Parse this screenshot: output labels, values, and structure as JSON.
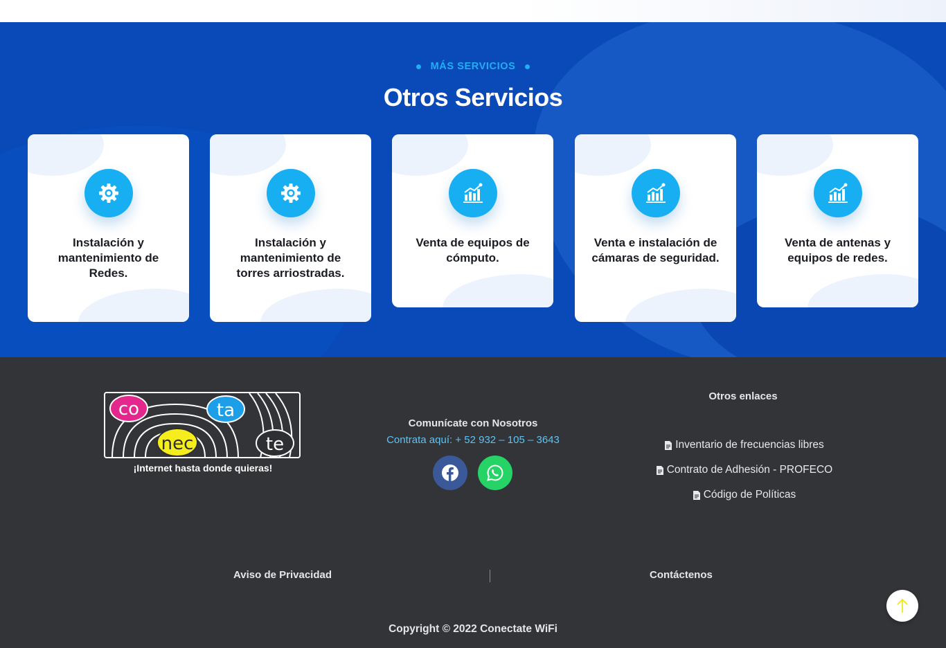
{
  "services": {
    "tag": "MÁS SERVICIOS",
    "title": "Otros Servicios",
    "cards": [
      {
        "icon": "gear-icon",
        "label": "Instalación y mantenimiento de Redes."
      },
      {
        "icon": "gear-icon",
        "label": "Instalación y mantenimiento de torres arriostradas."
      },
      {
        "icon": "chart-icon",
        "label": "Venta de equipos de cómputo."
      },
      {
        "icon": "chart-icon",
        "label": "Venta e instalación de cámaras de seguridad."
      },
      {
        "icon": "chart-icon",
        "label": "Venta de antenas y equipos de redes."
      }
    ]
  },
  "footer": {
    "logo": {
      "syllables": [
        "co",
        "ta",
        "nec",
        "te"
      ],
      "colors": {
        "co": "#e4278c",
        "ta": "#1d9ee8",
        "nec": "#f6ee1c",
        "te": "#2d2f32"
      }
    },
    "slogan": "¡Internet hasta donde quieras!",
    "contact": {
      "heading": "Comunícate con Nosotros",
      "line": "Contrata aquí: + 52 932 – 105 – 3643"
    },
    "social": {
      "facebook": "facebook-icon",
      "whatsapp": "whatsapp-icon"
    },
    "links": {
      "heading": "Otros enlaces",
      "items": [
        "Inventario de frecuencias libres",
        "Contrato de Adhesión - PROFECO",
        "Código de Políticas"
      ]
    },
    "bottom": {
      "privacy": "Aviso de Privacidad",
      "contact": "Contáctenos"
    },
    "copyright": "Copyright © 2022 Conectate WiFi"
  },
  "colors": {
    "services_bg": "#0a49b8",
    "accent": "#17aff2",
    "footer_bg": "#323437",
    "link": "#5dc3f4"
  }
}
